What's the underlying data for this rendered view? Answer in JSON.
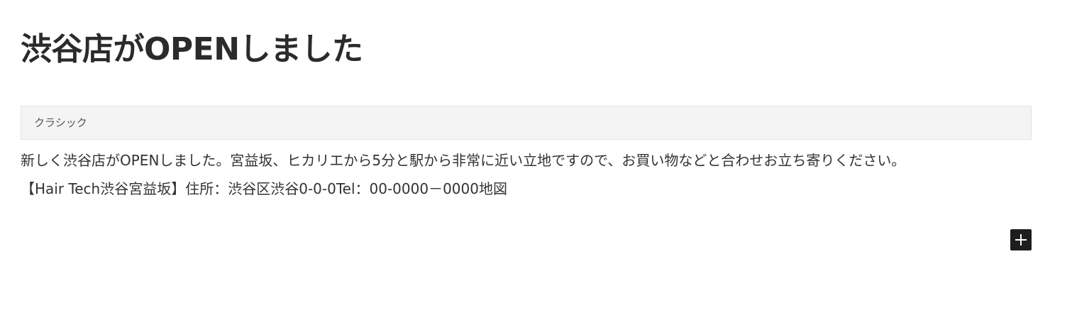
{
  "post": {
    "title": "渋谷店がOPENしました"
  },
  "classic_block": {
    "label": "クラシック"
  },
  "content": {
    "paragraph": "新しく渋谷店がOPENしました。宮益坂、ヒカリエから5分と駅から非常に近い立地ですので、お買い物などと合わせお立ち寄りください。",
    "store_info": "【Hair Tech渋谷宮益坂】住所：渋谷区渋谷0-0-0Tel：00-0000－0000地図"
  },
  "toolbar": {
    "add_block_icon": "plus-icon"
  },
  "colors": {
    "text": "#333333",
    "classic_block_background": "#f4f4f4",
    "add_button_background": "#1e1e1e"
  }
}
